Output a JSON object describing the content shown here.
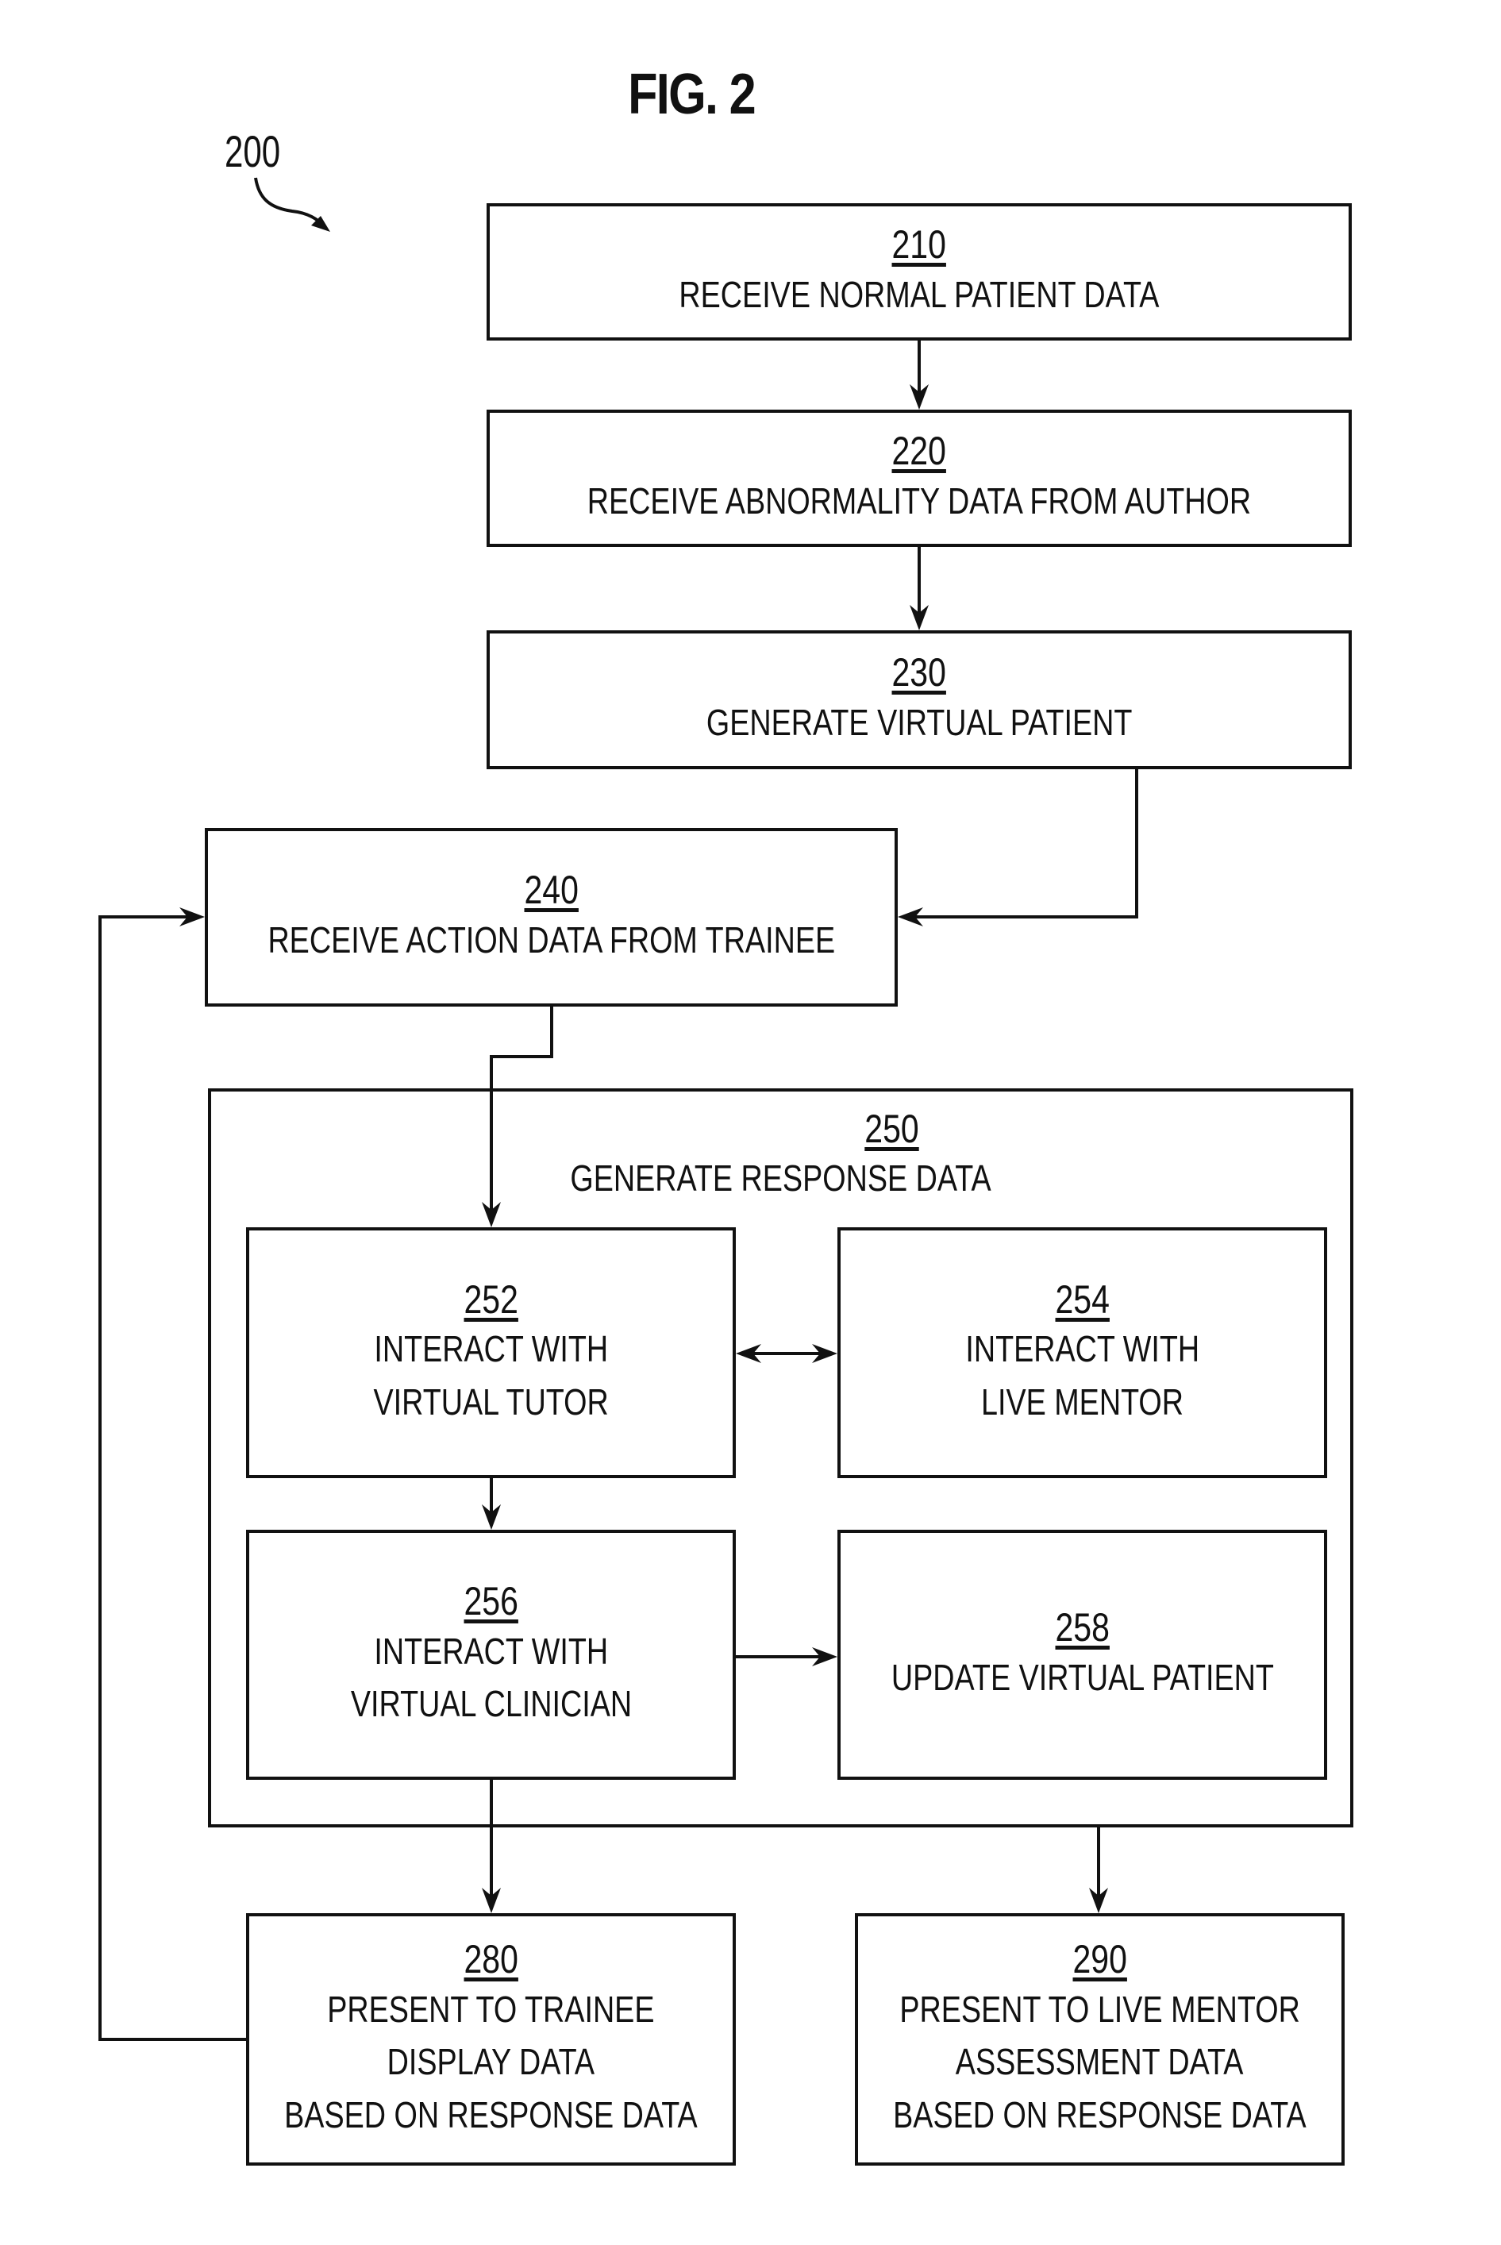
{
  "figure": {
    "title": "FIG. 2",
    "reference": "200"
  },
  "steps": {
    "s210": {
      "num": "210",
      "lines": [
        "RECEIVE NORMAL PATIENT DATA"
      ]
    },
    "s220": {
      "num": "220",
      "lines": [
        "RECEIVE ABNORMALITY DATA FROM AUTHOR"
      ]
    },
    "s230": {
      "num": "230",
      "lines": [
        "GENERATE VIRTUAL PATIENT"
      ]
    },
    "s240": {
      "num": "240",
      "lines": [
        "RECEIVE ACTION DATA FROM TRAINEE"
      ]
    },
    "s250": {
      "num": "250",
      "lines": [
        "GENERATE RESPONSE DATA"
      ]
    },
    "s252": {
      "num": "252",
      "lines": [
        "INTERACT WITH",
        "VIRTUAL TUTOR"
      ]
    },
    "s254": {
      "num": "254",
      "lines": [
        "INTERACT WITH",
        "LIVE MENTOR"
      ]
    },
    "s256": {
      "num": "256",
      "lines": [
        "INTERACT WITH",
        "VIRTUAL CLINICIAN"
      ]
    },
    "s258": {
      "num": "258",
      "lines": [
        "UPDATE VIRTUAL PATIENT"
      ]
    },
    "s280": {
      "num": "280",
      "lines": [
        "PRESENT TO TRAINEE",
        "DISPLAY DATA",
        "BASED ON RESPONSE DATA"
      ]
    },
    "s290": {
      "num": "290",
      "lines": [
        "PRESENT TO LIVE MENTOR",
        "ASSESSMENT DATA",
        "BASED ON RESPONSE DATA"
      ]
    }
  },
  "connections": [
    {
      "from": "210",
      "to": "220",
      "type": "arrow"
    },
    {
      "from": "220",
      "to": "230",
      "type": "arrow"
    },
    {
      "from": "230",
      "to": "240",
      "type": "arrow"
    },
    {
      "from": "240",
      "to": "252",
      "type": "arrow"
    },
    {
      "from": "252",
      "to": "254",
      "type": "bidirectional"
    },
    {
      "from": "252",
      "to": "256",
      "type": "arrow"
    },
    {
      "from": "256",
      "to": "258",
      "type": "arrow"
    },
    {
      "from": "256",
      "to": "280",
      "type": "arrow"
    },
    {
      "from": "250",
      "to": "290",
      "type": "arrow"
    },
    {
      "from": "280",
      "to": "240",
      "type": "arrow"
    }
  ]
}
